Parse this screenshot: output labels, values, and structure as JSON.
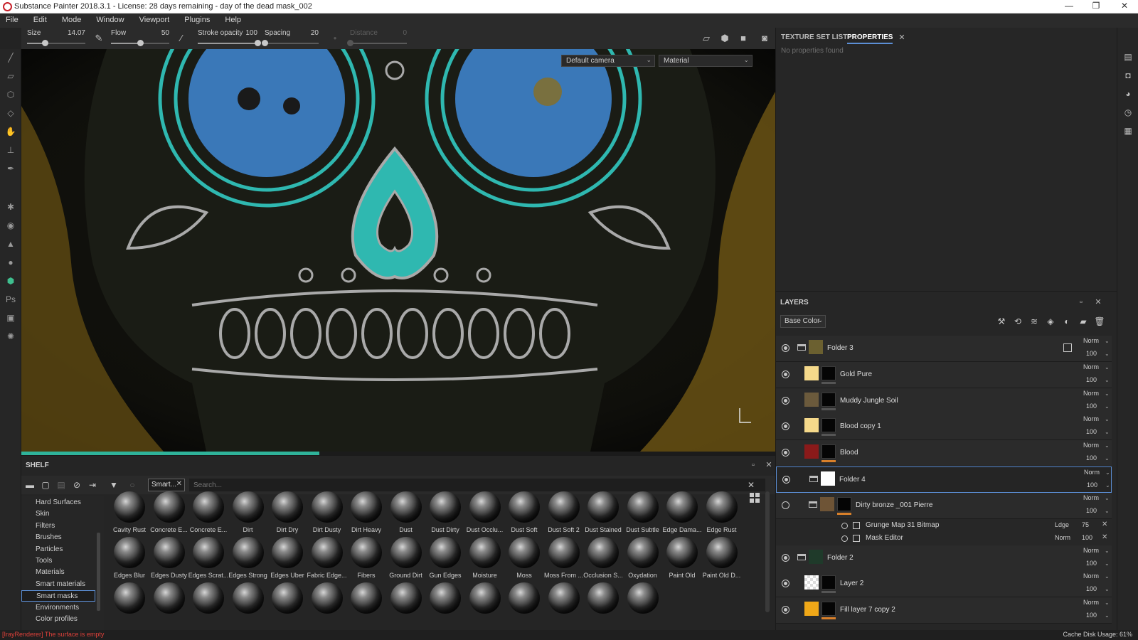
{
  "window": {
    "title": "Substance Painter 2018.3.1 - License: 28 days remaining - day of the dead mask_002",
    "minimize": "—",
    "maximize": "❐",
    "close": "✕"
  },
  "menu": [
    "File",
    "Edit",
    "Mode",
    "Window",
    "Viewport",
    "Plugins",
    "Help"
  ],
  "tool_options": {
    "size": {
      "label": "Size",
      "value": "14.07",
      "level": 0.3
    },
    "flow": {
      "label": "Flow",
      "value": "50",
      "level": 0.5
    },
    "stroke_opacity": {
      "label": "Stroke opacity",
      "value": "100",
      "level": 1.0
    },
    "spacing": {
      "label": "Spacing",
      "value": "20",
      "level": 0.0
    },
    "distance": {
      "label": "Distance",
      "value": "0",
      "level": 0.0
    }
  },
  "viewport": {
    "camera_select": "Default camera",
    "mode_select": "Material",
    "progress": 0.395,
    "colors": {
      "turquoise": "#2fb8b0",
      "blue": "#3a78b8",
      "gold": "#9c7a1c",
      "silver": "#a9a9a9"
    }
  },
  "shelf": {
    "title": "SHELF",
    "filter_chip": "Smart...",
    "search_placeholder": "Search...",
    "categories": [
      "Hard Surfaces",
      "Skin",
      "Filters",
      "Brushes",
      "Particles",
      "Tools",
      "Materials",
      "Smart materials",
      "Smart masks",
      "Environments",
      "Color profiles"
    ],
    "selected_category": "Smart masks",
    "items_row1": [
      "Cavity Rust",
      "Concrete E...",
      "Concrete E...",
      "Dirt",
      "Dirt Dry",
      "Dirt Dusty",
      "Dirt Heavy",
      "Dust",
      "Dust Dirty",
      "Dust Occlu...",
      "Dust Soft",
      "Dust Soft 2",
      "Dust Stained",
      "Dust Subtle",
      "Edge Dama...",
      "Edge Rust"
    ],
    "items_row2": [
      "Edges Blur",
      "Edges Dusty",
      "Edges Scrat...",
      "Edges Strong",
      "Edges Uber",
      "Fabric Edge...",
      "Fibers",
      "Ground Dirt",
      "Gun Edges",
      "Moisture",
      "Moss",
      "Moss From ...",
      "Occlusion S...",
      "Oxydation",
      "Paint Old",
      "Paint Old D..."
    ],
    "items_row3_count": 14
  },
  "properties": {
    "tab_texture_set": "TEXTURE SET LIST",
    "tab_properties": "PROPERTIES",
    "empty_text": "No properties found"
  },
  "layers": {
    "title": "LAYERS",
    "channel": "Base Color",
    "rows": [
      {
        "name": "Folder 3",
        "blend": "Norm",
        "opacity": "100",
        "visible": true,
        "kind": "folder"
      },
      {
        "name": "Gold Pure",
        "blend": "Norm",
        "opacity": "100",
        "visible": true,
        "kind": "fill",
        "color": "#f5d98a"
      },
      {
        "name": "Muddy Jungle Soil",
        "blend": "Norm",
        "opacity": "100",
        "visible": true,
        "kind": "fill",
        "color": "#6b5a3c"
      },
      {
        "name": "Blood copy 1",
        "blend": "Norm",
        "opacity": "100",
        "visible": true,
        "kind": "fill",
        "color": "#f5d98a"
      },
      {
        "name": "Blood",
        "blend": "Norm",
        "opacity": "100",
        "visible": true,
        "kind": "fill",
        "color": "#8a1a1a"
      },
      {
        "name": "Folder 4",
        "blend": "Norm",
        "opacity": "100",
        "visible": true,
        "kind": "folder",
        "selected": true
      },
      {
        "name": "Dirty bronze _001 Pierre",
        "blend": "Norm",
        "opacity": "100",
        "visible": false,
        "kind": "fill",
        "color": "#6e5436"
      },
      {
        "name": "Folder 2",
        "blend": "Norm",
        "opacity": "100",
        "visible": true,
        "kind": "folder"
      },
      {
        "name": "Layer 2",
        "blend": "Norm",
        "opacity": "100",
        "visible": true,
        "kind": "paint"
      },
      {
        "name": "Fill layer 7 copy 2",
        "blend": "Norm",
        "opacity": "100",
        "visible": true,
        "kind": "fill",
        "color": "#f0a818"
      }
    ],
    "effects": [
      {
        "name": "Grunge Map 31 Bitmap",
        "blend": "Ldge",
        "opacity": "75"
      },
      {
        "name": "Mask Editor",
        "blend": "Norm",
        "opacity": "100"
      }
    ]
  },
  "status": {
    "error": "[IrayRenderer] The surface is empty",
    "cache": "Cache Disk Usage:   61%"
  }
}
